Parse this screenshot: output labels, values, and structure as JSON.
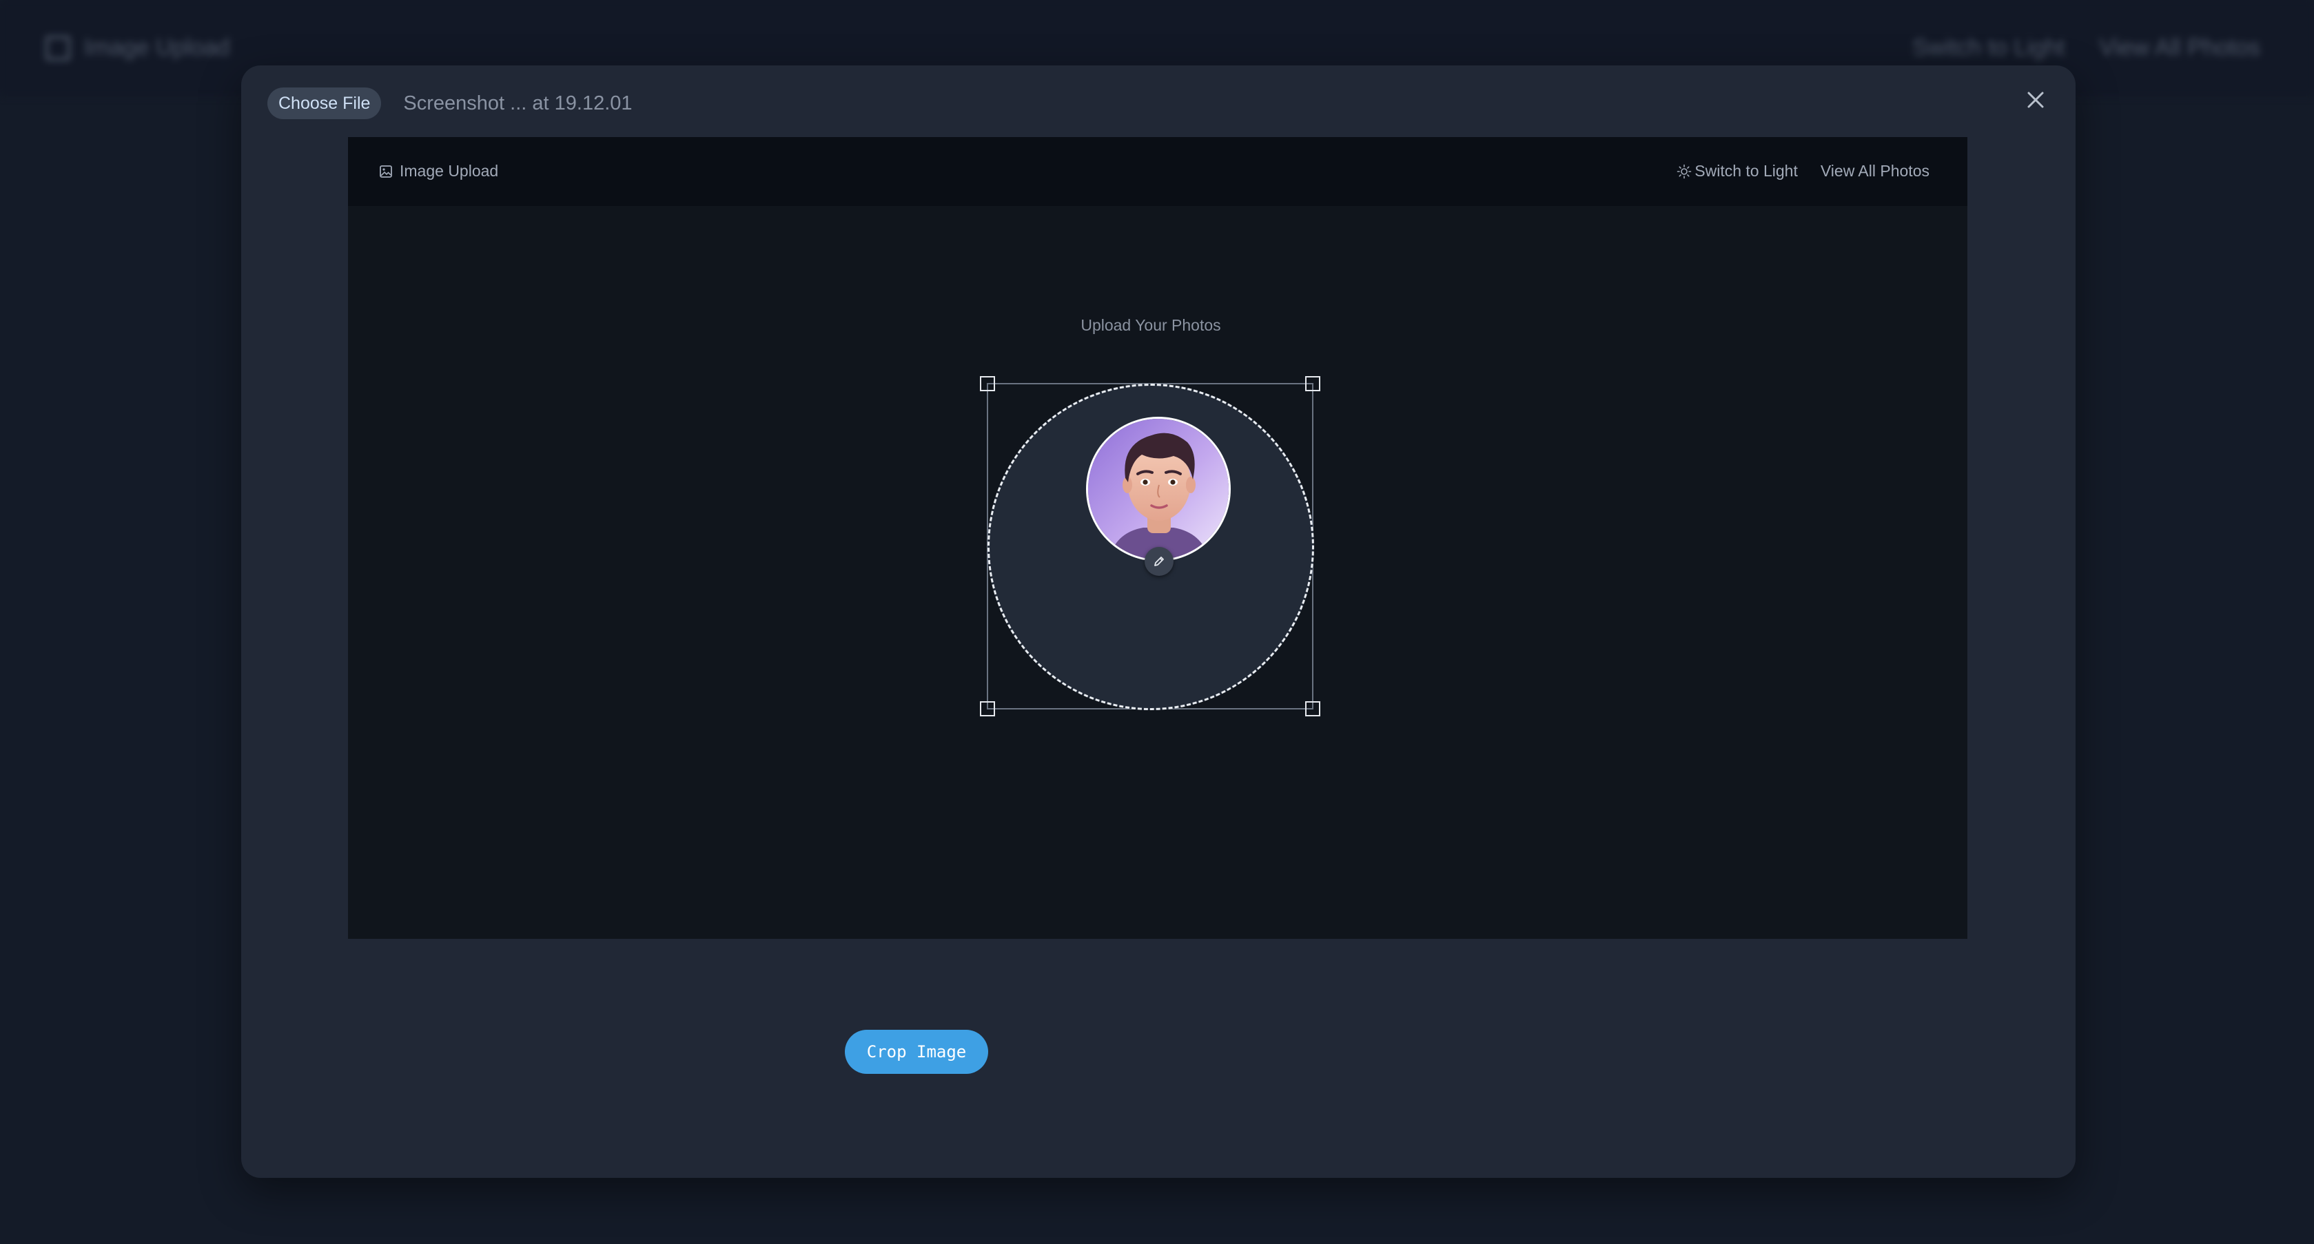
{
  "background": {
    "brand_label": "Image Upload",
    "nav": [
      "Switch to Light",
      "View All Photos"
    ]
  },
  "modal": {
    "choose_file_label": "Choose File",
    "file_name": "Screenshot ... at 19.12.01",
    "close_icon": "close-icon",
    "crop_button_label": "Crop Image"
  },
  "app": {
    "brand_label": "Image Upload",
    "brand_icon": "image-icon",
    "switch_theme_label": "Switch to Light",
    "switch_theme_icon": "sun-icon",
    "view_all_label": "View All Photos",
    "upload_title": "Upload Your Photos",
    "edit_icon": "pencil-icon"
  },
  "colors": {
    "accent": "#3ea0e4",
    "modal_bg": "#212836",
    "frame_bg": "#10151c"
  }
}
